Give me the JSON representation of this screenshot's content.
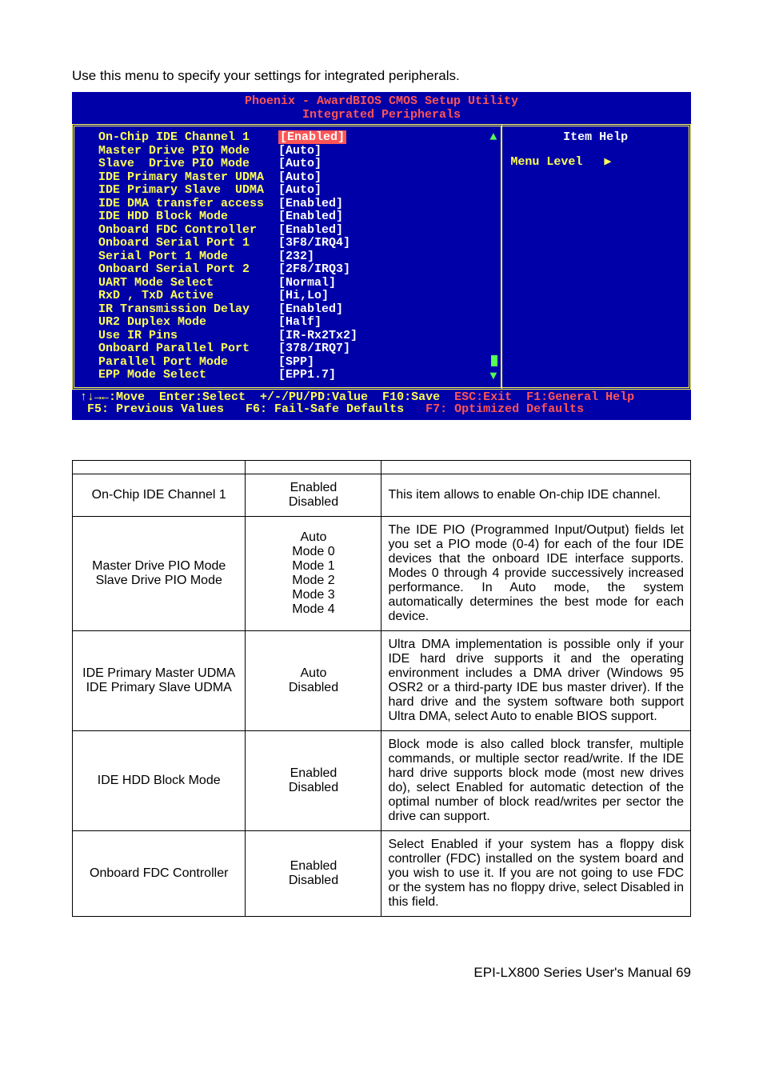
{
  "intro": "Use this menu to specify your settings for integrated peripherals.",
  "bios": {
    "title": "Phoenix - AwardBIOS CMOS Setup Utility",
    "subtitle": "Integrated Peripherals",
    "help_title": "Item Help",
    "menu_level_label": "Menu Level",
    "menu_level_arrow": "▶",
    "rows": [
      {
        "label": "On-Chip IDE Channel 1",
        "value": "[Enabled]",
        "sel": true
      },
      {
        "label": "Master Drive PIO Mode",
        "value": "[Auto]"
      },
      {
        "label": "Slave  Drive PIO Mode",
        "value": "[Auto]"
      },
      {
        "label": "IDE Primary Master UDMA",
        "value": "[Auto]"
      },
      {
        "label": "IDE Primary Slave  UDMA",
        "value": "[Auto]"
      },
      {
        "label": "IDE DMA transfer access",
        "value": "[Enabled]"
      },
      {
        "label": "IDE HDD Block Mode",
        "value": "[Enabled]"
      },
      {
        "label": "Onboard FDC Controller",
        "value": "[Enabled]"
      },
      {
        "label": "Onboard Serial Port 1",
        "value": "[3F8/IRQ4]"
      },
      {
        "label": "Serial Port 1 Mode",
        "value": "[232]"
      },
      {
        "label": "Onboard Serial Port 2",
        "value": "[2F8/IRQ3]"
      },
      {
        "label": "UART Mode Select",
        "value": "[Normal]"
      },
      {
        "label": "RxD , TxD Active",
        "value": "[Hi,Lo]"
      },
      {
        "label": "IR Transmission Delay",
        "value": "[Enabled]"
      },
      {
        "label": "UR2 Duplex Mode",
        "value": "[Half]"
      },
      {
        "label": "Use IR Pins",
        "value": "[IR-Rx2Tx2]"
      },
      {
        "label": "Onboard Parallel Port",
        "value": "[378/IRQ7]"
      },
      {
        "label": "Parallel Port Mode",
        "value": "[SPP]"
      },
      {
        "label": "EPP Mode Select",
        "value": "[EPP1.7]"
      }
    ],
    "footer": {
      "line1_left": "↑↓→←:Move  Enter:Select  +/-/PU/PD:Value  F10:Save",
      "line1_right": "  ESC:Exit  F1:General Help",
      "line2_left": " F5: Previous Values   F6: Fail-Safe Defaults",
      "line2_right": "   F7: Optimized Defaults"
    }
  },
  "table": {
    "rows": [
      {
        "name": "On-Chip IDE Channel 1",
        "options": "Enabled\nDisabled",
        "desc": "This item allows to enable On-chip IDE channel."
      },
      {
        "name": "Master Drive PIO Mode\nSlave Drive PIO Mode",
        "options": "Auto\nMode 0\nMode 1\nMode 2\nMode 3\nMode 4",
        "desc": "The IDE PIO (Programmed Input/Output) fields let you set a PIO mode (0-4) for each of the four IDE devices that the onboard IDE interface supports. Modes 0 through 4 provide successively increased performance. In Auto mode, the system automatically determines the best mode for each device."
      },
      {
        "name": "IDE Primary Master UDMA\nIDE Primary Slave UDMA",
        "options": "Auto\nDisabled",
        "desc": "Ultra DMA implementation is possible only if your IDE hard drive supports it and the operating environment includes a DMA driver (Windows 95 OSR2 or a third-party IDE bus master driver). If the hard drive and the system software both support Ultra DMA, select Auto to enable BIOS support."
      },
      {
        "name": "IDE HDD Block Mode",
        "options": "Enabled\nDisabled",
        "desc": "Block mode is also called block transfer, multiple commands, or multiple sector read/write. If the IDE hard drive supports block mode (most new drives do), select Enabled for automatic detection of the optimal number of block read/writes per sector the drive can support."
      },
      {
        "name": "Onboard FDC Controller",
        "options": "Enabled\nDisabled",
        "desc": "Select Enabled if your system has a floppy disk controller (FDC) installed on the system board and you wish to use it.  If you are not going to use FDC or the system has no floppy drive, select Disabled in this field."
      }
    ]
  },
  "footer": "EPI-LX800 Series User's Manual  69"
}
